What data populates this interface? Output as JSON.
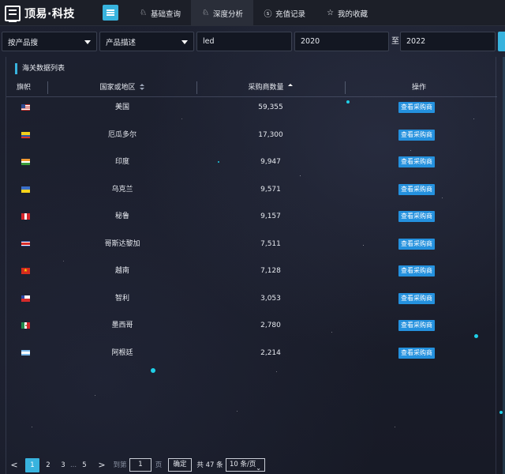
{
  "app": {
    "logo_text": "顶易·科技"
  },
  "nav": {
    "items": [
      {
        "label": "基础查询",
        "icon": "fox-icon"
      },
      {
        "label": "深度分析",
        "icon": "fox-icon"
      },
      {
        "label": "充值记录",
        "icon": "dollar-icon"
      },
      {
        "label": "我的收藏",
        "icon": "star-icon"
      }
    ],
    "active_index": 1
  },
  "search": {
    "mode_select": "按产品搜",
    "field_select": "产品描述",
    "keyword": "led",
    "year_from": "2020",
    "to_label": "至",
    "year_to": "2022"
  },
  "panel": {
    "title": "海关数据列表"
  },
  "table": {
    "headers": {
      "flag": "旗帜",
      "country": "国家或地区",
      "count": "采购商数量",
      "action": "操作"
    },
    "button_label": "查看采购商",
    "rows": [
      {
        "country": "美国",
        "count": "59,355",
        "flag": "us"
      },
      {
        "country": "厄瓜多尔",
        "count": "17,300",
        "flag": "ec"
      },
      {
        "country": "印度",
        "count": "9,947",
        "flag": "in"
      },
      {
        "country": "乌克兰",
        "count": "9,571",
        "flag": "ua"
      },
      {
        "country": "秘鲁",
        "count": "9,157",
        "flag": "pe"
      },
      {
        "country": "哥斯达黎加",
        "count": "7,511",
        "flag": "cr"
      },
      {
        "country": "越南",
        "count": "7,128",
        "flag": "vn"
      },
      {
        "country": "智利",
        "count": "3,053",
        "flag": "cl"
      },
      {
        "country": "墨西哥",
        "count": "2,780",
        "flag": "mx"
      },
      {
        "country": "阿根廷",
        "count": "2,214",
        "flag": "ar"
      }
    ]
  },
  "pagination": {
    "prev": "<",
    "pages": [
      "1",
      "2",
      "3"
    ],
    "ellipsis": "...",
    "last_page": "5",
    "next": ">",
    "goto_label": "到第",
    "goto_value": "1",
    "page_unit": "页",
    "confirm": "确定",
    "total": "共 47 条",
    "page_size": "10 条/页"
  }
}
